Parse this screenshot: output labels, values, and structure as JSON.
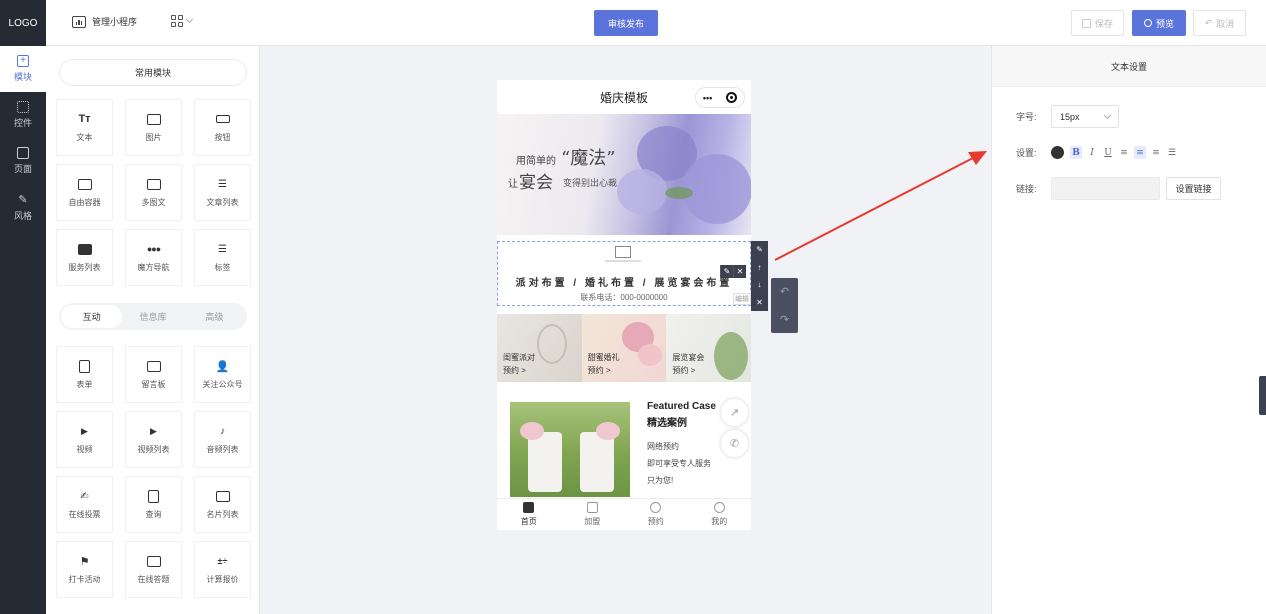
{
  "app": {
    "logo": "LOGO",
    "mini_program": "管理小程序",
    "publish": "审核发布",
    "save": "保存",
    "preview": "预览",
    "cancel": "取消"
  },
  "rail": [
    {
      "label": "模块",
      "icon": "plus-square-icon"
    },
    {
      "label": "控件",
      "icon": "keyboard-icon"
    },
    {
      "label": "页面",
      "icon": "page-icon"
    },
    {
      "label": "风格",
      "icon": "magic-wand-icon"
    }
  ],
  "panel": {
    "common_title": "常用模块",
    "common": [
      {
        "label": "文本",
        "icon": "text-icon"
      },
      {
        "label": "图片",
        "icon": "image-icon"
      },
      {
        "label": "按钮",
        "icon": "button-icon"
      },
      {
        "label": "自由容器",
        "icon": "container-icon"
      },
      {
        "label": "多图文",
        "icon": "multi-image-icon"
      },
      {
        "label": "文章列表",
        "icon": "article-list-icon"
      },
      {
        "label": "服务列表",
        "icon": "service-list-icon"
      },
      {
        "label": "魔方导航",
        "icon": "cube-nav-icon"
      },
      {
        "label": "标签",
        "icon": "tag-icon"
      }
    ],
    "tabs": [
      "互动",
      "信息库",
      "高级"
    ],
    "active_tab": "互动",
    "interactive": [
      {
        "label": "表单",
        "icon": "form-icon"
      },
      {
        "label": "留言板",
        "icon": "message-board-icon"
      },
      {
        "label": "关注公众号",
        "icon": "follow-account-icon"
      },
      {
        "label": "视频",
        "icon": "video-icon"
      },
      {
        "label": "视频列表",
        "icon": "video-list-icon"
      },
      {
        "label": "音频列表",
        "icon": "audio-list-icon"
      },
      {
        "label": "在线投票",
        "icon": "vote-icon"
      },
      {
        "label": "查询",
        "icon": "query-icon"
      },
      {
        "label": "名片列表",
        "icon": "card-list-icon"
      },
      {
        "label": "打卡活动",
        "icon": "check-in-icon"
      },
      {
        "label": "在线答题",
        "icon": "quiz-icon"
      },
      {
        "label": "计算报价",
        "icon": "calculator-icon"
      }
    ]
  },
  "phone": {
    "title": "婚庆模板",
    "capsule_more": "•••",
    "banner": {
      "line1": "用简单的",
      "magic": "“魔法”",
      "let": "让",
      "feast": "宴会",
      "line3": "变得别出心裁"
    },
    "services": "派对布置 / 婚礼布置 / 展览宴会布置",
    "contact": "联系电话：000-0000000",
    "cards": [
      {
        "name": "闺蜜派对",
        "sub": "预约 >"
      },
      {
        "name": "甜蜜婚礼",
        "sub": "预约 >"
      },
      {
        "name": "展览宴会",
        "sub": "预约 >"
      }
    ],
    "featured": {
      "en": "Featured Case",
      "cn": "精选案例",
      "lines": [
        "网络预约",
        "即可享受专人服务",
        "只为您!"
      ]
    },
    "tabs": [
      {
        "label": "首页",
        "active": true
      },
      {
        "label": "加盟",
        "active": false
      },
      {
        "label": "预约",
        "active": false
      },
      {
        "label": "我的",
        "active": false
      }
    ],
    "small_tag": "编辑"
  },
  "settings": {
    "title": "文本设置",
    "size_label": "字号:",
    "size_value": "15px",
    "style_label": "设置:",
    "color": "#333333",
    "formats": [
      "B",
      "I",
      "U",
      "≡",
      "≡",
      "≡",
      "☰"
    ],
    "link_label": "链接:",
    "link_button": "设置链接"
  },
  "colors": {
    "accent": "#5a74db",
    "dark": "#262b33",
    "arrow": "#e8392e"
  }
}
